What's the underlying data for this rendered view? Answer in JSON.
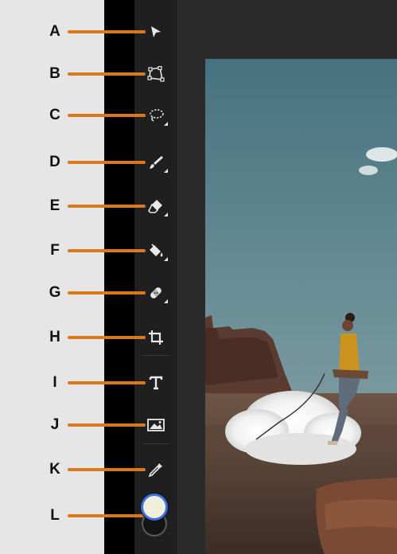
{
  "callout_labels": [
    "A",
    "B",
    "C",
    "D",
    "E",
    "F",
    "G",
    "H",
    "I",
    "J",
    "K",
    "L"
  ],
  "tools": [
    {
      "name": "select",
      "icon": "arrow-cursor-icon"
    },
    {
      "name": "transform",
      "icon": "transform-quad-icon"
    },
    {
      "name": "lasso",
      "icon": "lasso-icon",
      "has_submenu": true
    },
    {
      "name": "brush",
      "icon": "brush-icon",
      "has_submenu": true
    },
    {
      "name": "eraser",
      "icon": "eraser-icon",
      "has_submenu": true
    },
    {
      "name": "fill",
      "icon": "paint-bucket-icon",
      "has_submenu": true
    },
    {
      "name": "healing",
      "icon": "bandage-icon",
      "has_submenu": true
    },
    {
      "name": "crop",
      "icon": "crop-icon"
    },
    {
      "name": "type",
      "icon": "type-icon"
    },
    {
      "name": "place-image",
      "icon": "image-icon"
    },
    {
      "name": "eyedropper",
      "icon": "eyedropper-icon"
    },
    {
      "name": "color",
      "icon": "color-swatch-icon"
    }
  ],
  "colors": {
    "callout_line": "#d9781d",
    "toolbar_bg": "#1f1f1f",
    "foreground_swatch": "#f1eedb",
    "background_swatch": "#141414",
    "swatch_ring": "#3d6fe0"
  }
}
